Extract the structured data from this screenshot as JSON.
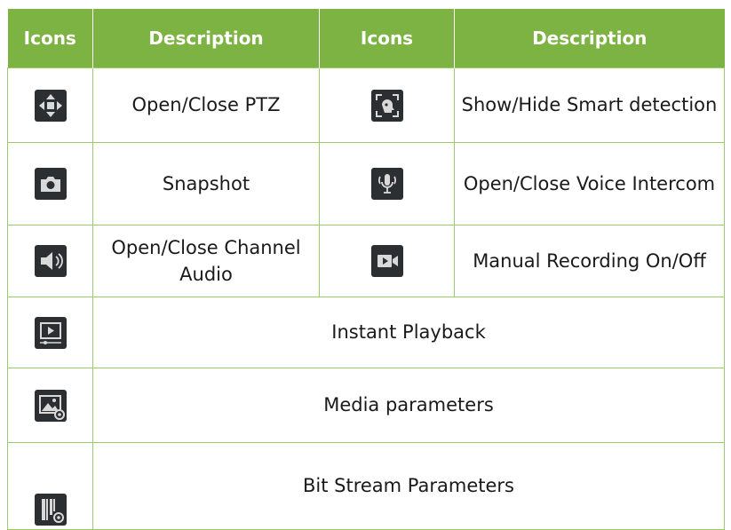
{
  "headers": [
    "Icons",
    "Description",
    "Icons",
    "Description"
  ],
  "rows": [
    {
      "left": {
        "icon": "ptz-icon",
        "description": "Open/Close PTZ"
      },
      "right": {
        "icon": "smart-detection-icon",
        "description": "Show/Hide Smart detection"
      }
    },
    {
      "left": {
        "icon": "camera-icon",
        "description": "Snapshot"
      },
      "right": {
        "icon": "microphone-icon",
        "description": "Open/Close Voice Intercom"
      }
    },
    {
      "left": {
        "icon": "speaker-icon",
        "description": "Open/Close Channel Audio"
      },
      "right": {
        "icon": "video-record-icon",
        "description": "Manual Recording On/Off"
      }
    }
  ],
  "wide_rows": [
    {
      "icon": "playback-icon",
      "description": "Instant Playback"
    },
    {
      "icon": "media-settings-icon",
      "description": "Media parameters"
    },
    {
      "icon": "bitstream-settings-icon",
      "description": "Bit Stream Parameters"
    }
  ],
  "colors": {
    "header_bg": "#7cb342",
    "border": "#9ccc65",
    "icon_bg": "#2b2f31",
    "icon_fg": "#d9d9d9"
  }
}
